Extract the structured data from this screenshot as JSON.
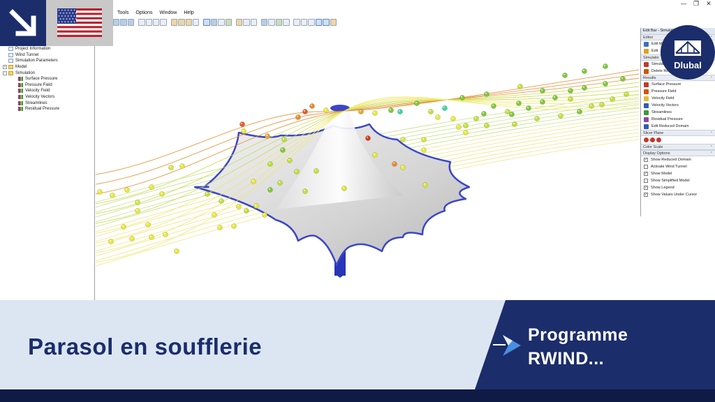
{
  "menu": [
    "Tools",
    "Options",
    "Window",
    "Help"
  ],
  "window_controls": [
    "—",
    "❐",
    "✕"
  ],
  "nav_tree": [
    {
      "label": "Project Information",
      "icon": "document-icon",
      "indent": 0
    },
    {
      "label": "Wind Tunnel",
      "icon": "document-icon",
      "indent": 0
    },
    {
      "label": "Simulation Parameters",
      "icon": "document-icon",
      "indent": 0
    },
    {
      "label": "Model",
      "icon": "folder-icon",
      "indent": 0,
      "expander": "+"
    },
    {
      "label": "Simulation",
      "icon": "folder-icon",
      "indent": 0,
      "expander": "−"
    },
    {
      "label": "Surface Pressure",
      "icon": "result-bars-icon",
      "indent": 1
    },
    {
      "label": "Pressure Field",
      "icon": "result-bars-icon",
      "indent": 1
    },
    {
      "label": "Velocity Field",
      "icon": "result-bars-icon",
      "indent": 1
    },
    {
      "label": "Velocity Vectors",
      "icon": "result-bars-icon",
      "indent": 1
    },
    {
      "label": "Streamlines",
      "icon": "result-bars-icon",
      "indent": 1
    },
    {
      "label": "Residual Pressure",
      "icon": "result-bars-icon",
      "indent": 1
    }
  ],
  "editbar": {
    "title": "Edit Bar - Simulatio",
    "editor_head": "Editor",
    "editor_items": [
      {
        "label": "Edit M",
        "color": "#3a6fc4"
      },
      {
        "label": "Edit",
        "color": "#e0a020"
      }
    ],
    "simulation_head": "Simulatio",
    "simulation_items": [
      {
        "label": "Simulati",
        "color": "#c0392b"
      },
      {
        "label": "Delete Resu",
        "color": "#d35400"
      }
    ],
    "results_head": "Results",
    "results_items": [
      {
        "label": "Surface Pressure",
        "color": "#c0392b"
      },
      {
        "label": "Pressure Field",
        "color": "#d35400"
      },
      {
        "label": "Velocity Field",
        "color": "#e6b93a"
      },
      {
        "label": "Velocity Vectors",
        "color": "#2e5fb0"
      },
      {
        "label": "Streamlines",
        "color": "#3a9a3a"
      },
      {
        "label": "Residual Pressure",
        "color": "#8e44ad"
      }
    ],
    "reduced_domain": "Edit Reduced Domain",
    "slicer_head": "Slicer Plane",
    "color_scale_head": "Color Scale",
    "display_head": "Display Options",
    "display_options": [
      {
        "label": "Show Reduced Domain",
        "checked": true
      },
      {
        "label": "Activate Wind Tunnel",
        "checked": false
      },
      {
        "label": "Show Model",
        "checked": true
      },
      {
        "label": "Show Simplified Model",
        "checked": false
      },
      {
        "label": "Show Legend",
        "checked": true
      },
      {
        "label": "Show Values Under Cursor",
        "checked": true
      }
    ]
  },
  "logo": {
    "brand": "Dlubal"
  },
  "banner": {
    "title": "Parasol en soufflerie",
    "program_line1": "Programme",
    "program_line2": "RWIND..."
  },
  "colors": {
    "brand_navy": "#1b2d6b",
    "band_light": "#dce6f3",
    "model_edge": "#3b46c8",
    "pole": "#2a35b8"
  },
  "icons": [
    "arrow-down-right-icon",
    "us-flag-icon",
    "bridge-logo-icon",
    "program-arrow-icon"
  ]
}
